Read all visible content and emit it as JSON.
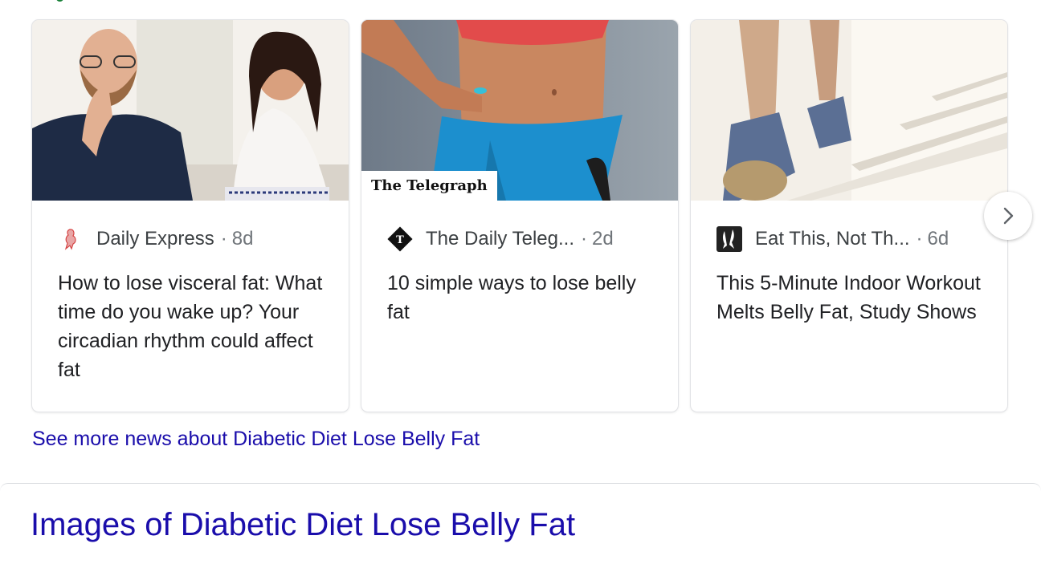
{
  "news": {
    "cards": [
      {
        "source": "Daily Express",
        "age": "8d",
        "title": "How to lose visceral fat: What time do you wake up? Your circadian rhythm could affect fat"
      },
      {
        "source": "The Daily Teleg...",
        "age": "2d",
        "title": "10 simple ways to lose belly fat",
        "image_badge": "The Telegraph"
      },
      {
        "source": "Eat This, Not Th...",
        "age": "6d",
        "title": "This 5-Minute Indoor Workout Melts Belly Fat, Study Shows"
      }
    ],
    "dot_separator": "·",
    "see_more": "See more news about Diabetic Diet Lose Belly Fat"
  },
  "images_section": {
    "heading": "Images of Diabetic Diet Lose Belly Fat"
  },
  "icons": {
    "next": "chevron-right-icon"
  },
  "colors": {
    "link": "#1a0dab",
    "text": "#202124",
    "meta": "#70757a",
    "accent_green": "#188038"
  }
}
